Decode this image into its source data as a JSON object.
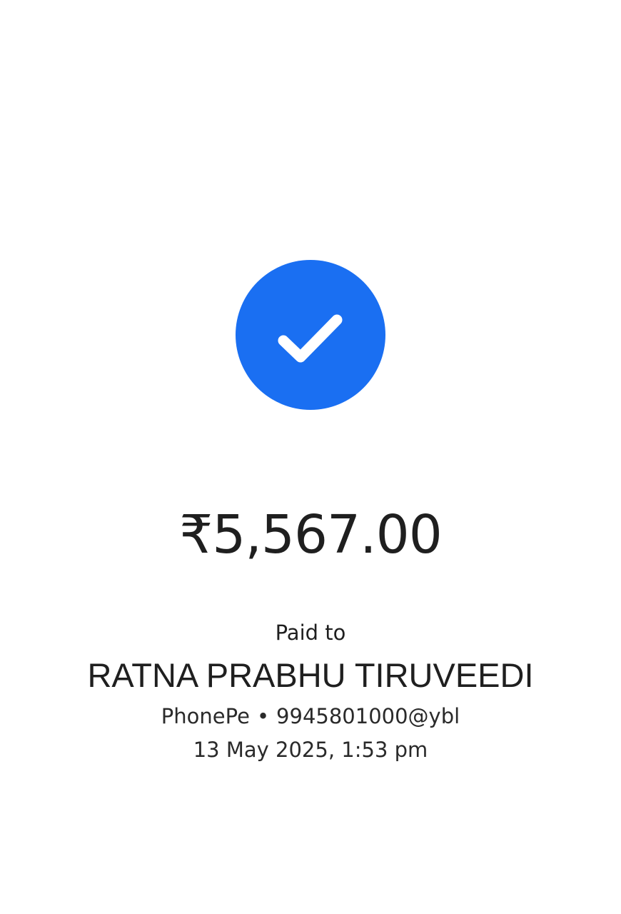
{
  "status": {
    "icon": "check-circle-icon",
    "color": "#1a6ff2"
  },
  "payment": {
    "amount": "₹5,567.00",
    "paid_to_label": "Paid to",
    "payee_name": "RATNA PRABHU TIRUVEEDI",
    "app": "PhonePe",
    "separator": "•",
    "upi_id": "9945801000@ybl",
    "timestamp": "13 May 2025, 1:53 pm"
  }
}
